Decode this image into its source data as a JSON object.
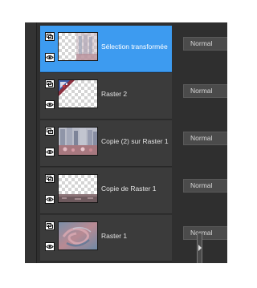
{
  "layers_panel": {
    "layers": [
      {
        "name": "Sélection transformée",
        "blend_mode": "Normal",
        "selected": true,
        "thumbnail": "semi-transparent-cityscape-on-checker",
        "visibility_icon": "eye-icon",
        "mode_icon": "layer-mode-icon"
      },
      {
        "name": "Raster 2",
        "blend_mode": "Normal",
        "selected": false,
        "thumbnail": "colorful-corner-pattern-on-checker",
        "visibility_icon": "eye-icon",
        "mode_icon": "layer-mode-icon"
      },
      {
        "name": "Copie (2) sur Raster 1",
        "blend_mode": "Normal",
        "selected": false,
        "thumbnail": "cityscape-photo",
        "visibility_icon": "eye-icon",
        "mode_icon": "layer-mode-icon"
      },
      {
        "name": "Copie de Raster 1",
        "blend_mode": "Normal",
        "selected": false,
        "thumbnail": "bottom-strip-on-checker",
        "visibility_icon": "eye-icon",
        "mode_icon": "layer-mode-icon"
      },
      {
        "name": "Raster 1",
        "blend_mode": "Normal",
        "selected": false,
        "thumbnail": "swirl-gradient",
        "visibility_icon": "eye-icon",
        "mode_icon": "layer-mode-icon"
      }
    ]
  },
  "colors": {
    "selection": "#3d9bf0",
    "panel_bg": "#2f2f2f",
    "row_bg": "#3b3b3b"
  }
}
